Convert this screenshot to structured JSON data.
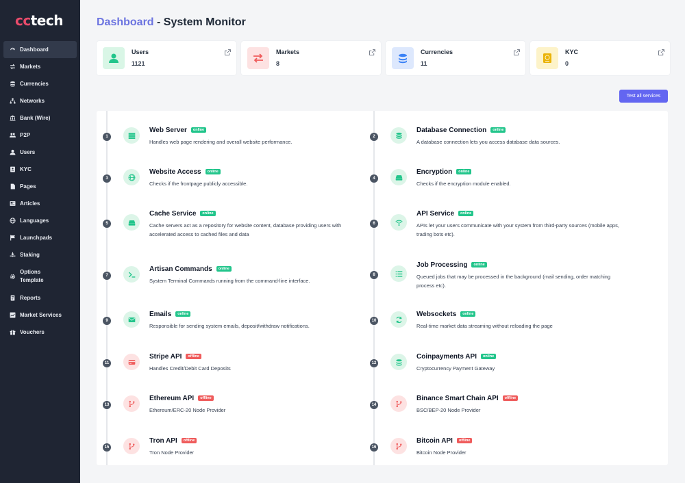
{
  "brand": {
    "part1": "cc",
    "part2": "tech"
  },
  "sidebar": {
    "items": [
      {
        "label": "Dashboard",
        "icon": "gauge-icon",
        "active": true
      },
      {
        "label": "Markets",
        "icon": "arrows-icon"
      },
      {
        "label": "Currencies",
        "icon": "coins-icon"
      },
      {
        "label": "Networks",
        "icon": "network-icon"
      },
      {
        "label": "Bank (Wire)",
        "icon": "bank-icon"
      },
      {
        "label": "P2P",
        "icon": "users-icon"
      },
      {
        "label": "Users",
        "icon": "user-icon"
      },
      {
        "label": "KYC",
        "icon": "id-card-icon"
      },
      {
        "label": "Pages",
        "icon": "file-icon"
      },
      {
        "label": "Articles",
        "icon": "newspaper-icon"
      },
      {
        "label": "Languages",
        "icon": "globe-icon"
      },
      {
        "label": "Launchpads",
        "icon": "flag-icon"
      },
      {
        "label": "Staking",
        "icon": "staking-icon"
      },
      {
        "label": "Options Template",
        "icon": "gear-icon"
      },
      {
        "label": "Reports",
        "icon": "report-icon"
      },
      {
        "label": "Market Services",
        "icon": "chart-icon"
      },
      {
        "label": "Vouchers",
        "icon": "gift-icon"
      }
    ]
  },
  "header": {
    "title_highlight": "Dashboard",
    "title_rest": " - System Monitor"
  },
  "cards": [
    {
      "name": "Users",
      "value": "1121",
      "icon": "user-icon",
      "color": "#22c58b",
      "bg": "#d9f6e6"
    },
    {
      "name": "Markets",
      "value": "8",
      "icon": "exchange-icon",
      "color": "#ef5b5b",
      "bg": "#fde2e2"
    },
    {
      "name": "Currencies",
      "value": "11",
      "icon": "coins-icon",
      "color": "#3b82f6",
      "bg": "#dde8fd"
    },
    {
      "name": "KYC",
      "value": "0",
      "icon": "passport-icon",
      "color": "#eab308",
      "bg": "#fdf3c9"
    }
  ],
  "actions": {
    "test_all": "Test all services"
  },
  "status_labels": {
    "online": "online",
    "offline": "offline"
  },
  "services": [
    {
      "num": "1",
      "name": "Web Server",
      "status": "online",
      "desc": "Handles web page rendering and overall website performance.",
      "icon": "server-icon"
    },
    {
      "num": "2",
      "name": "Database Connection",
      "status": "online",
      "desc": "A database connection lets you access database data sources.",
      "icon": "database-icon"
    },
    {
      "num": "3",
      "name": "Website Access",
      "status": "online",
      "desc": "Checks if the frontpage publicly accessible.",
      "icon": "globe-icon"
    },
    {
      "num": "4",
      "name": "Encryption",
      "status": "online",
      "desc": "Checks if the encryption module enabled.",
      "icon": "drive-icon"
    },
    {
      "num": "5",
      "name": "Cache Service",
      "status": "online",
      "desc": "Cache servers act as a repository for website content, database providing users with accelerated access to cached files and data",
      "icon": "drive-icon"
    },
    {
      "num": "6",
      "name": "API Service",
      "status": "online",
      "desc": "APIs let your users communicate with your system from third-party sources (mobile apps, trading bots etc).",
      "icon": "wifi-icon"
    },
    {
      "num": "7",
      "name": "Artisan Commands",
      "status": "online",
      "desc": "System Terminal Commands running from the command-line interface.",
      "icon": "terminal-icon"
    },
    {
      "num": "8",
      "name": "Job Processing",
      "status": "online",
      "desc": "Queued jobs that may be processed in the background (mail sending, order matching process etc).",
      "icon": "list-icon"
    },
    {
      "num": "9",
      "name": "Emails",
      "status": "online",
      "desc": "Responsible for sending system emails, deposit/withdraw notifications.",
      "icon": "mail-icon"
    },
    {
      "num": "10",
      "name": "Websockets",
      "status": "online",
      "desc": "Real-time market data streaming without reloading the page",
      "icon": "refresh-icon"
    },
    {
      "num": "11",
      "name": "Stripe API",
      "status": "offline",
      "desc": "Handles Credit/Debit Card Deposits",
      "icon": "credit-card-icon"
    },
    {
      "num": "12",
      "name": "Coinpayments API",
      "status": "online",
      "desc": "Cryptocurrency Payment Gateway",
      "icon": "coins-icon"
    },
    {
      "num": "13",
      "name": "Ethereum API",
      "status": "offline",
      "desc": "Ethereum/ERC-20 Node Provider",
      "icon": "branch-icon"
    },
    {
      "num": "14",
      "name": "Binance Smart Chain API",
      "status": "offline",
      "desc": "BSC/BEP-20 Node Provider",
      "icon": "branch-icon"
    },
    {
      "num": "15",
      "name": "Tron API",
      "status": "offline",
      "desc": "Tron Node Provider",
      "icon": "branch-icon"
    },
    {
      "num": "16",
      "name": "Bitcoin API",
      "status": "offline",
      "desc": "Bitcoin Node Provider",
      "icon": "branch-icon"
    }
  ]
}
